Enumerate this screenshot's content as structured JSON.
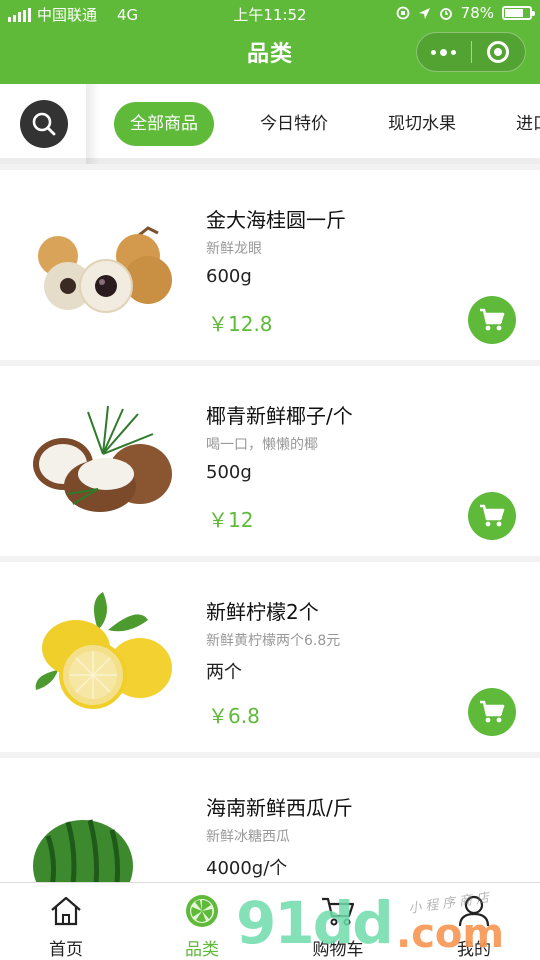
{
  "status_bar": {
    "carrier": "中国联通",
    "network": "4G",
    "time": "上午11:52",
    "battery": "78%"
  },
  "nav": {
    "title": "品类"
  },
  "categories": [
    {
      "label": "全部商品",
      "active": true
    },
    {
      "label": "今日特价",
      "active": false
    },
    {
      "label": "现切水果",
      "active": false
    },
    {
      "label": "进口",
      "active": false
    }
  ],
  "products": [
    {
      "name": "金大海桂圆一斤",
      "desc": "新鲜龙眼",
      "spec": "600g",
      "price": "￥12.8",
      "image": "longan"
    },
    {
      "name": "椰青新鲜椰子/个",
      "desc": "喝一口，懒懒的椰",
      "spec": "500g",
      "price": "￥12",
      "image": "coconut"
    },
    {
      "name": "新鲜柠檬2个",
      "desc": "新鲜黄柠檬两个6.8元",
      "spec": "两个",
      "price": "￥6.8",
      "image": "lemon"
    },
    {
      "name": "海南新鲜西瓜/斤",
      "desc": "新鲜冰糖西瓜",
      "spec": "4000g/个",
      "price": "",
      "image": "watermelon"
    }
  ],
  "tabbar": [
    {
      "label": "首页",
      "icon": "home-icon",
      "active": false
    },
    {
      "label": "品类",
      "icon": "lime-icon",
      "active": true
    },
    {
      "label": "购物车",
      "icon": "cart-icon",
      "active": false
    },
    {
      "label": "我的",
      "icon": "user-icon",
      "active": false
    }
  ],
  "watermark": {
    "main": "91dd",
    "dot": ".com",
    "sub": "小程序商店"
  },
  "colors": {
    "accent": "#5fba3a",
    "header": "#5fba3a"
  }
}
